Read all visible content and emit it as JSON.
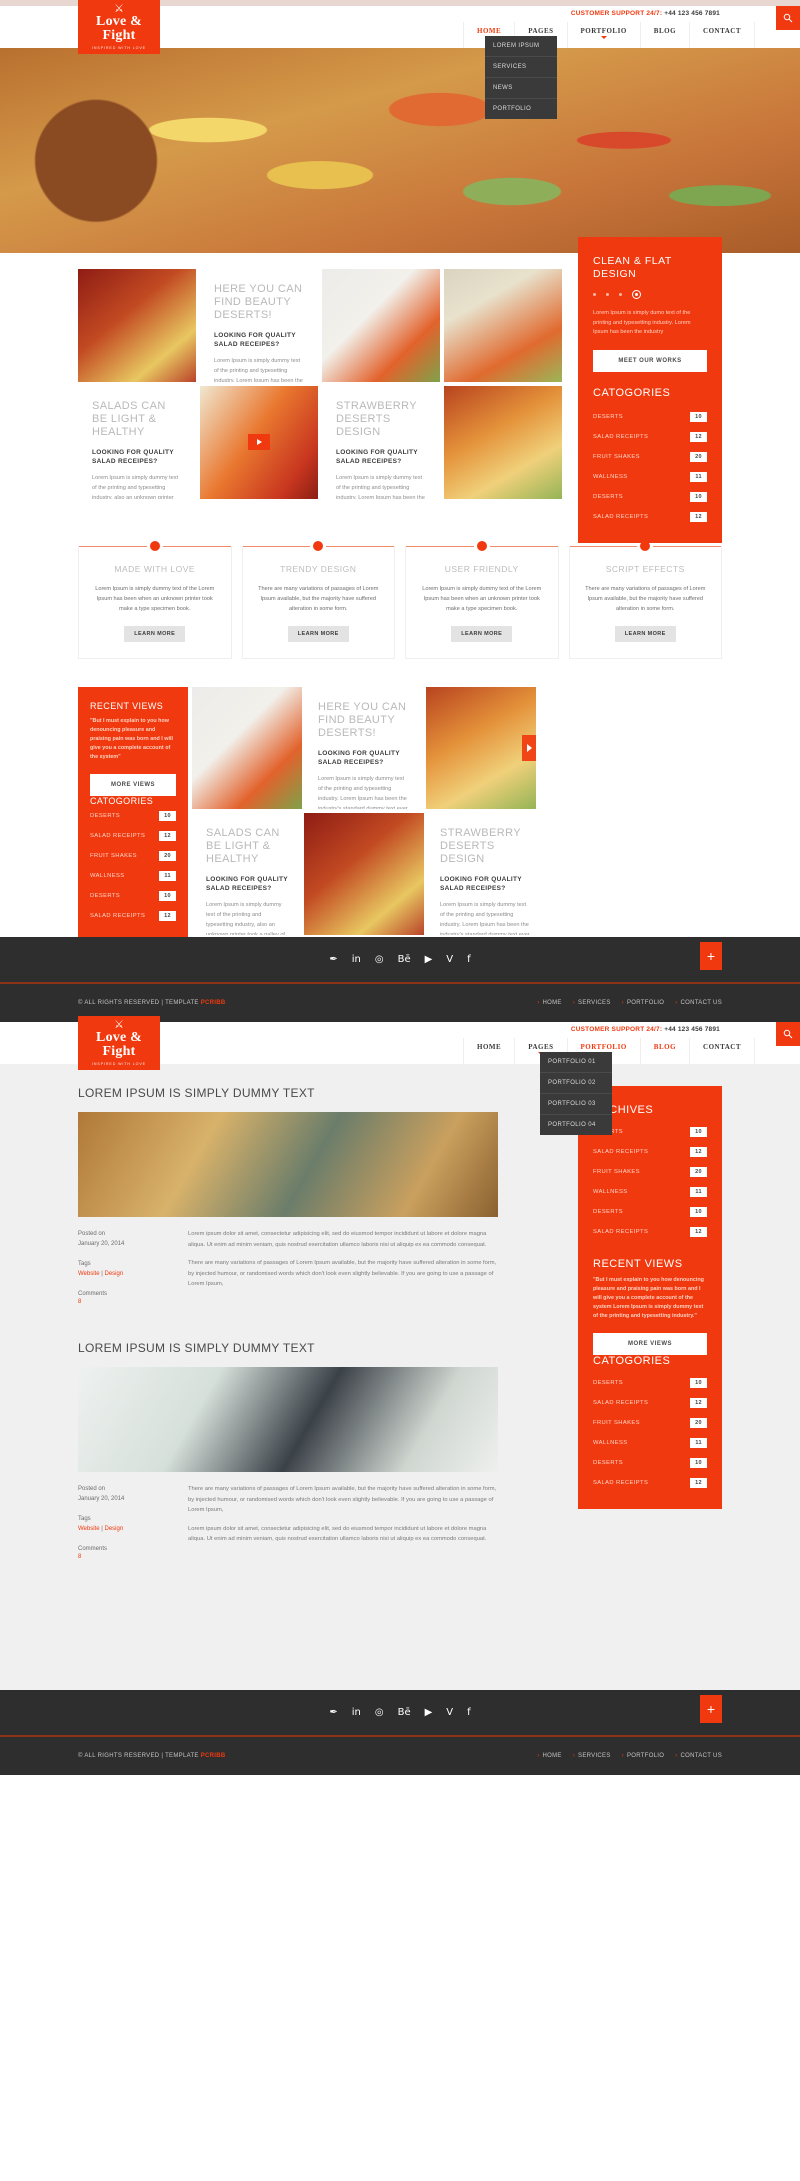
{
  "brand": {
    "name": "Love & Fight",
    "tagline": "INSPIRED WITH LOVE",
    "cross_icon": "crossed-utensils-icon"
  },
  "header": {
    "support_label": "CUSTOMER SUPPORT 24/7:",
    "support_phone": "+44 123 456 7891",
    "search_icon": "search-icon",
    "nav": [
      {
        "label": "HOME",
        "active": true,
        "caret": false
      },
      {
        "label": "PAGES",
        "active": false,
        "caret": true
      },
      {
        "label": "PORTFOLIO",
        "active": false,
        "caret": true
      },
      {
        "label": "BLOG",
        "active": false,
        "caret": false
      },
      {
        "label": "CONTACT",
        "active": false,
        "caret": false
      }
    ],
    "pages_dropdown": [
      "LOREM IPSUM",
      "SERVICES",
      "NEWS",
      "PORTFOLIO"
    ]
  },
  "header2": {
    "support_label": "CUSTOMER SUPPORT 24/7:",
    "support_phone": "+44 123 456 7891",
    "nav": [
      {
        "label": "HOME",
        "active": false,
        "caret": false
      },
      {
        "label": "PAGES",
        "active": false,
        "caret": true
      },
      {
        "label": "PORTFOLIO",
        "active": true,
        "caret": true
      },
      {
        "label": "BLOG",
        "active": true,
        "caret": false
      },
      {
        "label": "CONTACT",
        "active": false,
        "caret": false
      }
    ],
    "portfolio_dropdown": [
      "PORTFOLIO 01",
      "PORTFOLIO 02",
      "PORTFOLIO 03",
      "PORTFOLIO 04"
    ]
  },
  "gallery": {
    "card1": {
      "title": "HERE YOU CAN FIND BEAUTY DESERTS!",
      "subtitle": "LOOKING FOR QUALITY SALAD RECEIPES?",
      "body": "Lorem Ipsum is simply dummy text of the printing and typesetting industry. Lorem Ipsum has been the industry's standard dummy text ever"
    },
    "card2": {
      "title": "SALADS CAN BE LIGHT & HEALTHY",
      "subtitle": "LOOKING FOR QUALITY SALAD RECEIPES?",
      "body": "Lorem Ipsum is simply dummy text of the printing and typesetting industry, also an unknown printer took a galley of type and scrambled it to make specimen book."
    },
    "card3": {
      "title": "STRAWBERRY DESERTS DESIGN",
      "subtitle": "LOOKING FOR QUALITY SALAD RECEIPES?",
      "body": "Lorem Ipsum is simply dummy text of the printing and typesetting industry. Lorem Ipsum has been the industry's standard dummy text ever"
    }
  },
  "promo": {
    "title": "CLEAN & FLAT DESIGN",
    "description": "Lorem Ipsum is simply dumo text of the printing and typesetting industry. Lorem Ipsum has been the industry",
    "button": "MEET OUR WORKS",
    "slider_dots": 4,
    "active_dot": 3
  },
  "categories_title": "CATOGORIES",
  "archives_title": "ARCHIVES",
  "categories": [
    {
      "label": "DESERTS",
      "count": "10"
    },
    {
      "label": "SALAD RECEIPTS",
      "count": "12"
    },
    {
      "label": "FRUIT SHAKES",
      "count": "20"
    },
    {
      "label": "WALLNESS",
      "count": "11"
    },
    {
      "label": "DESERTS",
      "count": "10"
    },
    {
      "label": "SALAD RECEIPTS",
      "count": "12"
    }
  ],
  "features": [
    {
      "title": "MADE WITH LOVE",
      "body": "Lorem Ipsum is simply dummy text of the Lorem Ipsum has been when an unknown printer took make a type specimen book.",
      "button": "LEARN MORE"
    },
    {
      "title": "TRENDY DESIGN",
      "body": "There are many variations of passages of Lorem Ipsum available, but the majority have suffered alteration in some form.",
      "button": "LEARN MORE"
    },
    {
      "title": "USER FRIENDLY",
      "body": "Lorem Ipsum is simply dummy text of the Lorem Ipsum has been when an unknown printer took make a type specimen book.",
      "button": "LEARN MORE"
    },
    {
      "title": "SCRIPT EFFECTS",
      "body": "There are many variations of passages of Lorem Ipsum available, but the majority have suffered alteration in some form.",
      "button": "LEARN MORE"
    }
  ],
  "recent_views": {
    "title": "RECENT VIEWS",
    "quote": "\"But I must explain to you how denouncing pleasure and praising pain was born and I will give you a complete account of the system\"",
    "button": "MORE VIEWS"
  },
  "recent_views_blog": {
    "title": "RECENT VIEWS",
    "quote": "\"But I must explain to you how denouncing pleasure and praising pain was born and I will give you a complete account of the system Lorem Ipsum is simply dummy text of the printing and typesetting industry.\"",
    "button": "MORE VIEWS"
  },
  "social": [
    {
      "name": "twitter-icon",
      "glyph": "✒"
    },
    {
      "name": "linkedin-icon",
      "glyph": "in"
    },
    {
      "name": "dribbble-icon",
      "glyph": "◎"
    },
    {
      "name": "behance-icon",
      "glyph": "Bē"
    },
    {
      "name": "youtube-icon",
      "glyph": "▶"
    },
    {
      "name": "vimeo-icon",
      "glyph": "V"
    },
    {
      "name": "facebook-icon",
      "glyph": "f"
    }
  ],
  "footer": {
    "plus_label": "+",
    "copyright_prefix": "© ALL RIGHTS RESERVED | TEMPLATE ",
    "copyright_brand": "PCRIBB",
    "links": [
      "HOME",
      "SERVICES",
      "PORTFOLIO",
      "CONTACT US"
    ]
  },
  "blog": {
    "posts": [
      {
        "title": "LOREM IPSUM IS SIMPLY DUMMY TEXT",
        "posted_label": "Posted on",
        "posted_date": "January 20, 2014",
        "tags_label": "Tags",
        "tag1": "Website",
        "tag_sep": "|",
        "tag2": "Design",
        "comments_label": "Comments",
        "comments_count": "8",
        "paragraphs": [
          "Lorem ipsum dolor sit amet, consectetur adipisicing elit, sed do eiusmod tempor incididunt ut labore et dolore magna aliqua. Ut enim ad minim veniam, quis nostrud exercitation ullamco laboris nisi ut aliquip ex ea commodo consequat.",
          "There are many variations of passages of Lorem Ipsum available, but the majority have suffered alteration in some form, by injected humour, or randomised words which don't look even slightly believable. If you are going to use a passage of Lorem Ipsum,"
        ]
      },
      {
        "title": "LOREM IPSUM IS SIMPLY DUMMY TEXT",
        "posted_label": "Posted on",
        "posted_date": "January 20, 2014",
        "tags_label": "Tags",
        "tag1": "Website",
        "tag_sep": "|",
        "tag2": "Design",
        "comments_label": "Comments",
        "comments_count": "8",
        "paragraphs": [
          "There are many variations of passages of Lorem Ipsum available, but the majority have suffered alteration in some form, by injected humour, or randomised words which don't look even slightly believable. If you are going to use a passage of Lorem Ipsum,",
          "Lorem ipsum dolor sit amet, consectetur adipisicing elit, sed do eiusmod tempor incididunt ut labore et dolore magna aliqua. Ut enim ad minim veniam, quis nostrud exercitation ullamco laboris nisi ut aliquip ex ea commodo consequat."
        ]
      }
    ]
  },
  "colors": {
    "accent": "#F0390F",
    "dark": "#2E2E2E",
    "muted": "#BCBCBC"
  }
}
